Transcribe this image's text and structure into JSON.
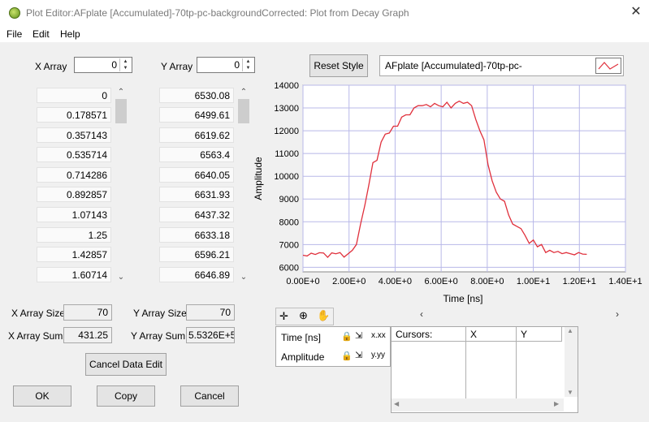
{
  "window": {
    "title": "Plot Editor:AFplate [Accumulated]-70tp-pc-backgroundCorrected: Plot from Decay Graph",
    "close_glyph": "✕"
  },
  "menu": {
    "items": [
      "File",
      "Edit",
      "Help"
    ]
  },
  "x_array": {
    "label": "X Array",
    "index": "0",
    "values": [
      "0",
      "0.178571",
      "0.357143",
      "0.535714",
      "0.714286",
      "0.892857",
      "1.07143",
      "1.25",
      "1.42857",
      "1.60714"
    ]
  },
  "y_array": {
    "label": "Y Array",
    "index": "0",
    "values": [
      "6530.08",
      "6499.61",
      "6619.62",
      "6563.4",
      "6640.05",
      "6631.93",
      "6437.32",
      "6633.18",
      "6596.21",
      "6646.89"
    ]
  },
  "stats": {
    "x_size_label": "X Array Size",
    "x_size": "70",
    "y_size_label": "Y Array Size",
    "y_size": "70",
    "x_sum_label": "X Array Sum",
    "x_sum": "431.25",
    "y_sum_label": "Y Array Sum",
    "y_sum": "5.5326E+5"
  },
  "buttons": {
    "cancel_edit": "Cancel Data Edit",
    "ok": "OK",
    "copy": "Copy",
    "cancel": "Cancel",
    "reset_style": "Reset Style"
  },
  "plot_name": "AFplate [Accumulated]-70tp-pc-",
  "cursor_panel": {
    "rows": [
      {
        "label": "Time [ns]",
        "fmt": "x.xx"
      },
      {
        "label": "Amplitude",
        "fmt": "y.yy"
      }
    ]
  },
  "cursor_table": {
    "headers": [
      "Cursors:",
      "X",
      "Y"
    ]
  },
  "chart_data": {
    "type": "line",
    "xlabel": "Time [ns]",
    "ylabel": "Amplitude",
    "xlim": [
      0,
      14
    ],
    "ylim": [
      5800,
      14000
    ],
    "xticks": [
      "0.00E+0",
      "2.00E+0",
      "4.00E+0",
      "6.00E+0",
      "8.00E+0",
      "1.00E+1",
      "1.20E+1",
      "1.40E+1"
    ],
    "yticks": [
      "6000",
      "7000",
      "8000",
      "9000",
      "10000",
      "11000",
      "12000",
      "13000",
      "14000"
    ],
    "grid": true,
    "line_color": "#e0303c",
    "grid_color": "#b8b8e8",
    "series": [
      {
        "x": [
          0,
          0.179,
          0.357,
          0.536,
          0.714,
          0.893,
          1.071,
          1.25,
          1.429,
          1.607,
          1.786,
          1.964,
          2.143,
          2.321,
          2.5,
          2.679,
          2.857,
          3.036,
          3.214,
          3.393,
          3.571,
          3.75,
          3.929,
          4.107,
          4.286,
          4.464,
          4.643,
          4.821,
          5.0,
          5.179,
          5.357,
          5.536,
          5.714,
          5.893,
          6.071,
          6.25,
          6.429,
          6.607,
          6.786,
          6.964,
          7.143,
          7.321,
          7.5,
          7.679,
          7.857,
          8.036,
          8.214,
          8.393,
          8.571,
          8.75,
          8.929,
          9.107,
          9.286,
          9.464,
          9.643,
          9.821,
          10.0,
          10.179,
          10.357,
          10.536,
          10.714,
          10.893,
          11.071,
          11.25,
          11.429,
          11.607,
          11.786,
          11.964,
          12.143,
          12.321
        ],
        "y": [
          6530,
          6500,
          6620,
          6563,
          6640,
          6632,
          6437,
          6633,
          6596,
          6647,
          6450,
          6600,
          6750,
          7000,
          7900,
          8700,
          9600,
          10600,
          10700,
          11500,
          11850,
          11900,
          12200,
          12200,
          12600,
          12700,
          12700,
          13000,
          13100,
          13100,
          13150,
          13050,
          13200,
          13100,
          13050,
          13250,
          13000,
          13200,
          13300,
          13200,
          13250,
          13100,
          12500,
          12000,
          11600,
          10500,
          9800,
          9300,
          9000,
          8900,
          8300,
          7900,
          7800,
          7700,
          7400,
          7050,
          7200,
          6900,
          7000,
          6650,
          6750,
          6650,
          6700,
          6600,
          6650,
          6600,
          6550,
          6650,
          6580,
          6570
        ]
      }
    ]
  }
}
